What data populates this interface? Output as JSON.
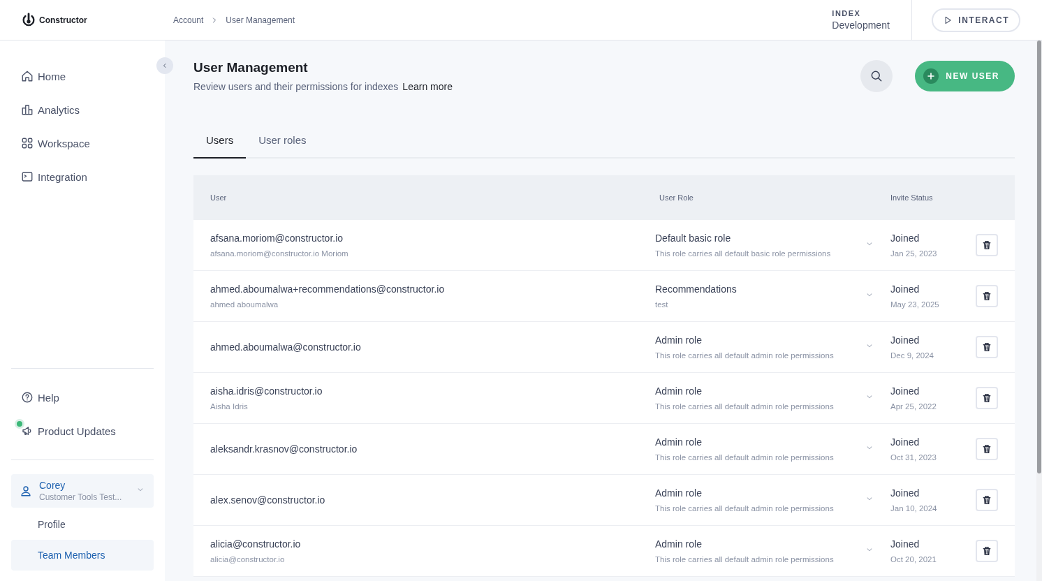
{
  "header": {
    "logo": "Constructor",
    "breadcrumbs": [
      "Account",
      "User Management"
    ],
    "index_label": "INDEX",
    "index_value": "Development",
    "interact": "INTERACT"
  },
  "sidebar": {
    "items": [
      {
        "label": "Home",
        "kind": "home"
      },
      {
        "label": "Analytics",
        "kind": "analytics"
      },
      {
        "label": "Workspace",
        "kind": "workspace"
      },
      {
        "label": "Integration",
        "kind": "integration"
      }
    ],
    "bottom_items": [
      {
        "label": "Help",
        "kind": "help",
        "unread": false
      },
      {
        "label": "Product Updates",
        "kind": "updates",
        "unread": true
      }
    ],
    "account": {
      "name": "Corey",
      "org": "Customer Tools Test...",
      "expanded": true,
      "items": [
        {
          "label": "Profile",
          "selected": false
        },
        {
          "label": "Team Members",
          "selected": true
        }
      ]
    }
  },
  "page": {
    "title": "User Management",
    "subtitle": "Review users and their permissions for indexes",
    "learn_more": "Learn more",
    "new_user": "NEW USER"
  },
  "tabs": [
    {
      "label": "Users",
      "selected": true
    },
    {
      "label": "User roles",
      "selected": false
    }
  ],
  "table": {
    "columns": [
      "User",
      "User Role",
      "Invite Status"
    ],
    "rows": [
      {
        "email": "afsana.moriom@constructor.io",
        "name": "afsana.moriom@constructor.io Moriom",
        "role": "Default basic role",
        "role_desc": "This role carries all default basic role permissions",
        "status": "Joined",
        "date": "Jan 25, 2023"
      },
      {
        "email": "ahmed.aboumalwa+recommendations@constructor.io",
        "name": "ahmed aboumalwa",
        "role": "Recommendations",
        "role_desc": "test",
        "status": "Joined",
        "date": "May 23, 2025"
      },
      {
        "email": "ahmed.aboumalwa@constructor.io",
        "role": "Admin role",
        "role_desc": "This role carries all default admin role permissions",
        "status": "Joined",
        "date": "Dec 9, 2024"
      },
      {
        "email": "aisha.idris@constructor.io",
        "name": "Aisha Idris",
        "role": "Admin role",
        "role_desc": "This role carries all default admin role permissions",
        "status": "Joined",
        "date": "Apr 25, 2022"
      },
      {
        "email": "aleksandr.krasnov@constructor.io",
        "role": "Admin role",
        "role_desc": "This role carries all default admin role permissions",
        "status": "Joined",
        "date": "Oct 31, 2023"
      },
      {
        "email": "alex.senov@constructor.io",
        "role": "Admin role",
        "role_desc": "This role carries all default admin role permissions",
        "status": "Joined",
        "date": "Jan 10, 2024"
      },
      {
        "email": "alicia@constructor.io",
        "name": "alicia@constructor.io",
        "role": "Admin role",
        "role_desc": "This role carries all default admin role permissions",
        "status": "Joined",
        "date": "Oct 20, 2021"
      }
    ]
  }
}
